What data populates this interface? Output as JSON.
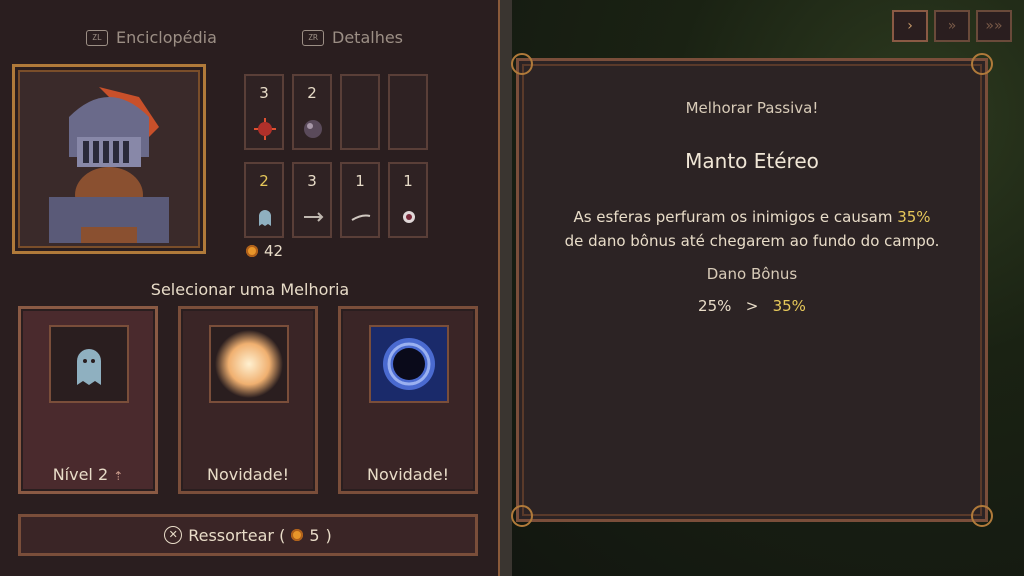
{
  "header": {
    "encyclopedia": {
      "button": "ZL",
      "label": "Enciclopédia"
    },
    "details": {
      "button": "ZR",
      "label": "Detalhes"
    }
  },
  "slots": [
    {
      "count": "3",
      "icon": "spiked-orb-icon",
      "highlight": false
    },
    {
      "count": "2",
      "icon": "dark-orb-icon",
      "highlight": false
    },
    {
      "count": "",
      "icon": "",
      "highlight": false
    },
    {
      "count": "",
      "icon": "",
      "highlight": false
    },
    {
      "count": "2",
      "icon": "ghost-icon",
      "highlight": true
    },
    {
      "count": "3",
      "icon": "arrow-icon",
      "highlight": false
    },
    {
      "count": "1",
      "icon": "feather-icon",
      "highlight": false
    },
    {
      "count": "1",
      "icon": "eye-orb-icon",
      "highlight": false
    }
  ],
  "coins": "42",
  "selection": {
    "title": "Selecionar uma Melhoria",
    "cards": [
      {
        "label": "Nível 2",
        "icon": "ghost-icon"
      },
      {
        "label": "Novidade!",
        "icon": "burst-orb-icon"
      },
      {
        "label": "Novidade!",
        "icon": "vortex-orb-icon"
      }
    ]
  },
  "reroll": {
    "button": "✕",
    "label": "Ressortear (",
    "cost": "5",
    "close": ")"
  },
  "detail": {
    "subtitle": "Melhorar Passiva!",
    "name": "Manto Etéreo",
    "desc_line1_pre": "As esferas perfuram os inimigos e causam ",
    "desc_line1_hl": "35%",
    "desc_line2": "de dano bônus até chegarem ao fundo do campo.",
    "stat_label": "Dano Bônus",
    "stat_from": "25%",
    "stat_arrow": ">",
    "stat_to": "35%"
  },
  "speed": [
    "›",
    "»",
    "»»"
  ],
  "colors": {
    "highlight": "#e6c85a",
    "frame": "#7a4e3a",
    "panel": "#2c2324"
  }
}
